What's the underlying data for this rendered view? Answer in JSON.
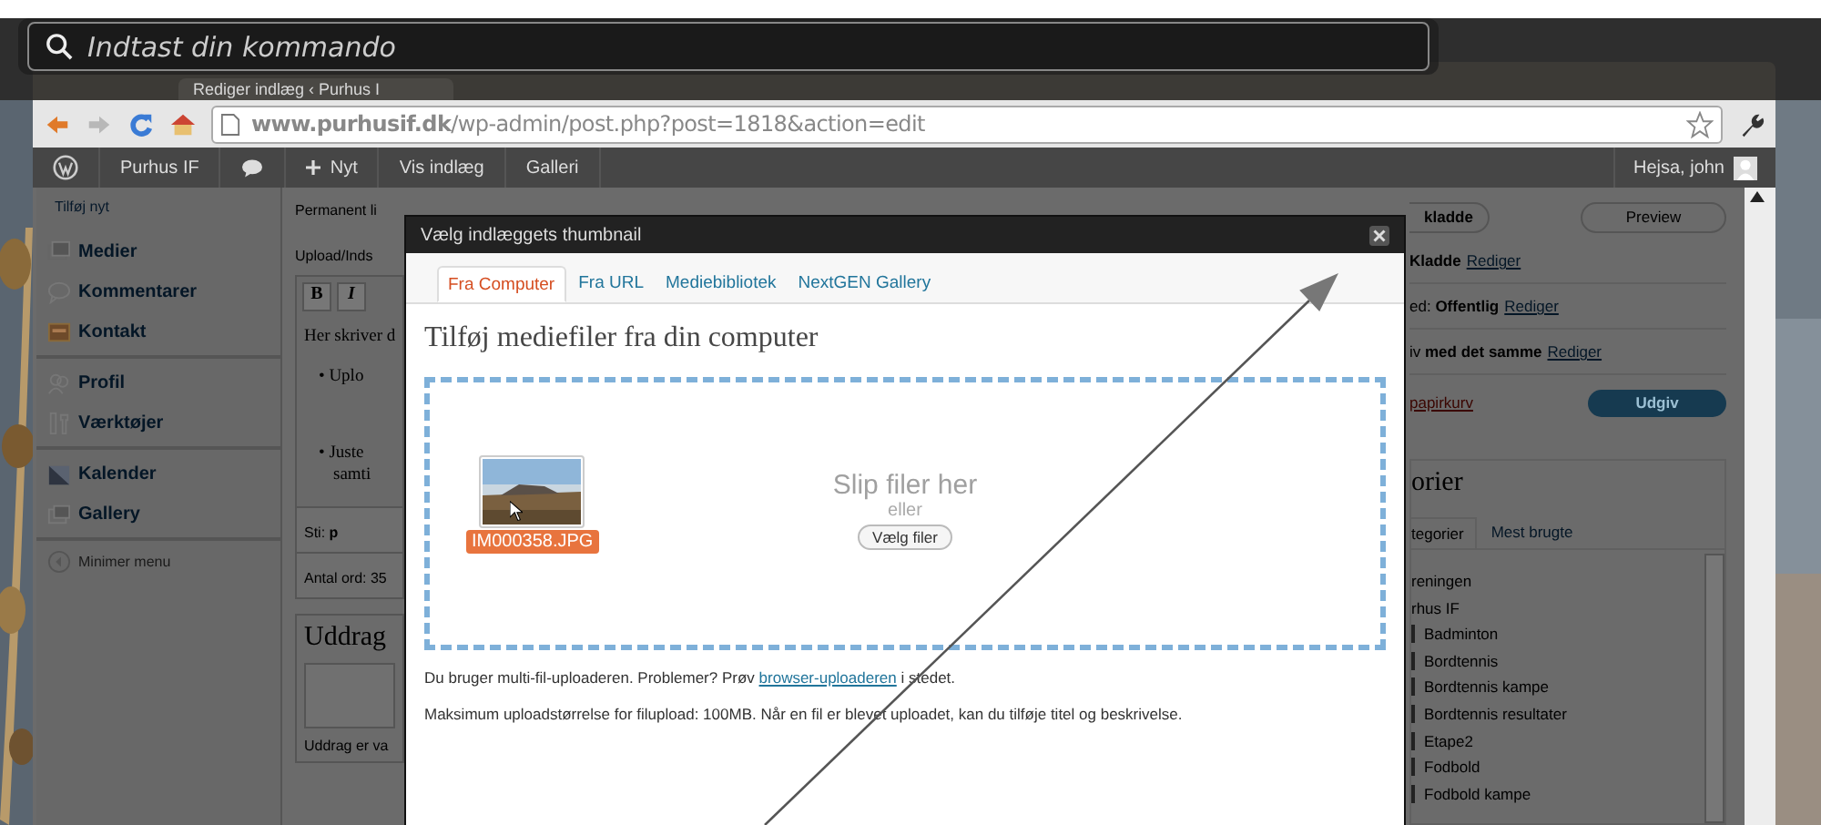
{
  "command_bar": {
    "placeholder": "Indtast din kommando"
  },
  "browser": {
    "tab_title": "Rediger indlæg ‹ Purhus I",
    "url": "**www.purhusif.dk**/wp-admin/post.php?post=1818&action=edit"
  },
  "admin_bar": {
    "items": [
      {
        "kind": "logo"
      },
      {
        "kind": "link",
        "label": "Purhus IF"
      },
      {
        "kind": "comments"
      },
      {
        "kind": "new",
        "label": "Nyt"
      },
      {
        "kind": "link",
        "label": "Vis indlæg"
      },
      {
        "kind": "link",
        "label": "Galleri"
      }
    ],
    "greeting": "Hejsa, john"
  },
  "sidebar": {
    "add_new": "Tilføj nyt",
    "groups": [
      [
        {
          "kind": "media",
          "label": "Medier"
        },
        {
          "kind": "comments",
          "label": "Kommentarer"
        },
        {
          "kind": "contact",
          "label": "Kontakt"
        }
      ],
      [
        {
          "kind": "profile",
          "label": "Profil"
        },
        {
          "kind": "tools",
          "label": "Værktøjer"
        }
      ],
      [
        {
          "kind": "calendar",
          "label": "Kalender"
        },
        {
          "kind": "gallery",
          "label": "Gallery"
        }
      ]
    ],
    "collapse": "Minimer menu"
  },
  "editor": {
    "permalink": "Permanent li",
    "upload": "Upload/Inds",
    "format_buttons": [
      "B",
      "I"
    ],
    "lines": [
      {
        "kind": "paragraph",
        "text": "Her skriver d"
      },
      {
        "kind": "bullet",
        "text": "• Uplo"
      },
      {
        "kind": "bullet",
        "text": "• Juste"
      },
      {
        "kind": "continuation",
        "text": "samti"
      }
    ],
    "path": "Sti: **p**",
    "word_count": "Antal ord: 35"
  },
  "excerpt": {
    "title": "Uddrag",
    "note": "Uddrag er va"
  },
  "publish": {
    "draft_button": "kladde",
    "preview_button": "Preview",
    "rows": [
      {
        "text": "**Kladde**",
        "link": "Rediger"
      },
      {
        "text": "ed: **Offentlig**",
        "link": "Rediger"
      },
      {
        "text": "iv **med det samme**",
        "link": "Rediger"
      }
    ],
    "trash": "papirkurv",
    "publish_button": "Udgiv"
  },
  "categories": {
    "title": "orier",
    "tabs": [
      {
        "label": "tegorier",
        "selected": true
      },
      {
        "label": "Mest brugte",
        "selected": false
      }
    ],
    "items": [
      {
        "label": "reningen"
      },
      {
        "label": "rhus IF",
        "children": [
          {
            "label": "Badminton"
          },
          {
            "label": "Bordtennis"
          },
          {
            "label": "Bordtennis kampe"
          },
          {
            "label": "Bordtennis resultater"
          },
          {
            "label": "Etape2"
          },
          {
            "label": "Fodbold"
          },
          {
            "label": "Fodbold kampe"
          }
        ]
      }
    ]
  },
  "modal": {
    "title": "Vælg indlæggets thumbnail",
    "tabs": [
      {
        "label": "Fra Computer",
        "selected": true
      },
      {
        "label": "Fra URL",
        "selected": false
      },
      {
        "label": "Mediebibliotek",
        "selected": false
      },
      {
        "label": "NextGEN Gallery",
        "selected": false
      }
    ],
    "heading": "Tilføj mediefiler fra din computer",
    "file_name": "IM000358.JPG",
    "drop_text": "Slip filer her",
    "or": "eller",
    "select_button": "Vælg filer",
    "uploader_note": {
      "before": "Du bruger multi-fil-uploaderen. Problemer? Prøv",
      "link": "browser-uploaderen",
      "after": "i stedet."
    },
    "max_size": "Maksimum uploadstørrelse for filupload: 100MB. Når en fil er blevet uploadet, kan du tilføje titel og beskrivelse."
  }
}
